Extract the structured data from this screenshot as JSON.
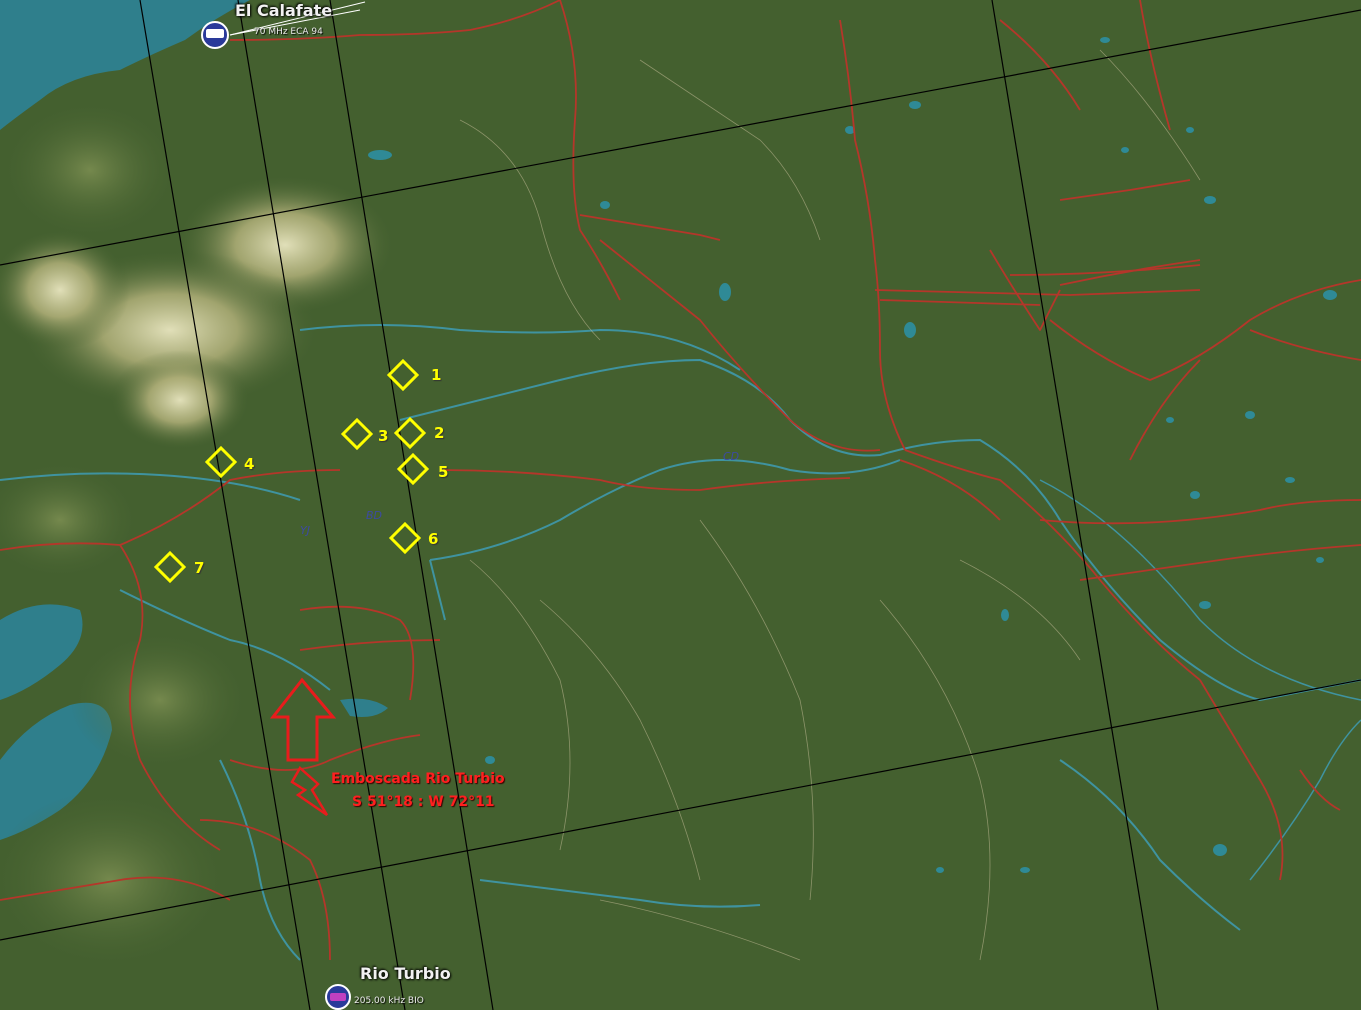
{
  "cities": {
    "el_calafate": {
      "name": "El Calafate",
      "radio": "70 MHz ECA 94"
    },
    "rio_turbio": {
      "name": "Rio Turbio",
      "radio": "205.00 kHz BIO"
    }
  },
  "waypoints": [
    {
      "id": "wp1",
      "label": "1"
    },
    {
      "id": "wp2",
      "label": "2"
    },
    {
      "id": "wp3",
      "label": "3"
    },
    {
      "id": "wp4",
      "label": "4"
    },
    {
      "id": "wp5",
      "label": "5"
    },
    {
      "id": "wp6",
      "label": "6"
    },
    {
      "id": "wp7",
      "label": "7"
    }
  ],
  "map_codes": {
    "cd": "CD",
    "bd": "BD",
    "yj": "YJ"
  },
  "ambush": {
    "title": "Emboscada Rio Turbio",
    "coords": "S 51°18 : W 72°11"
  },
  "colors": {
    "terrain": "#44602f",
    "water": "#2f8a96",
    "rivers": "#3f93a0",
    "roads": "#b5362a",
    "mountain": "#d8d8a8",
    "grid": "#000000",
    "waypoint": "#ffff00",
    "ambush": "#ff1f1f"
  }
}
